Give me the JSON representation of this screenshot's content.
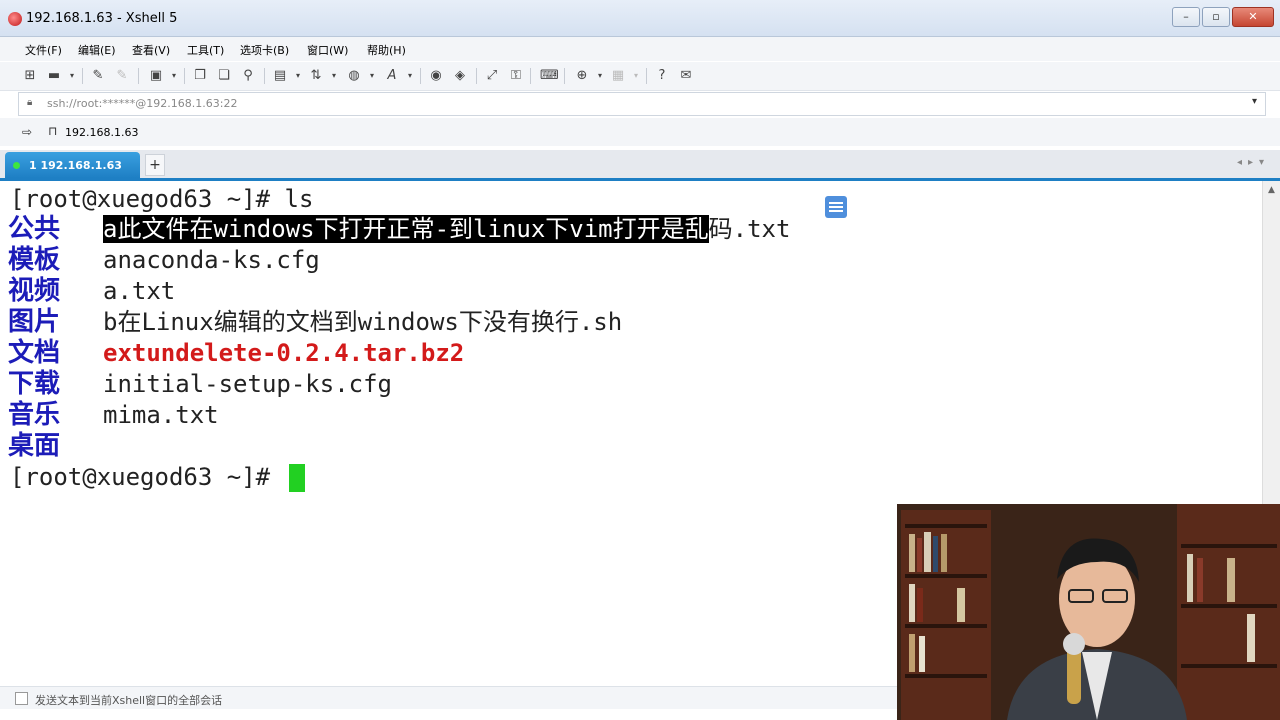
{
  "window": {
    "title": "192.168.1.63 - Xshell 5"
  },
  "menu": [
    "文件(F)",
    "编辑(E)",
    "查看(V)",
    "工具(T)",
    "选项卡(B)",
    "窗口(W)",
    "帮助(H)"
  ],
  "address": {
    "value": "ssh://root:******@192.168.1.63:22"
  },
  "links": {
    "label": "192.168.1.63"
  },
  "tabs": [
    {
      "label": "1 192.168.1.63"
    }
  ],
  "terminal": {
    "prompt": "[root@xuegod63 ~]# ",
    "command": "ls",
    "dirs": [
      "公共",
      "模板",
      "视频",
      "图片",
      "文档",
      "下载",
      "音乐",
      "桌面"
    ],
    "files": {
      "f1_selected": "a此文件在windows下打开正常-到linux下vim打开是乱",
      "f1_rest": "码.txt",
      "f2": "anaconda-ks.cfg",
      "f3": "a.txt",
      "f4": "b在Linux编辑的文档到windows下没有换行.sh",
      "f5": "extundelete-0.2.4.tar.bz2",
      "f6": "initial-setup-ks.cfg",
      "f7": "mima.txt"
    }
  },
  "status": {
    "text": "发送文本到当前Xshell窗口的全部会话"
  },
  "colors": {
    "dir": "#1c1cb8",
    "archive": "#d31a1a",
    "cursor": "#22d022",
    "tab": "#1e7fc4"
  }
}
